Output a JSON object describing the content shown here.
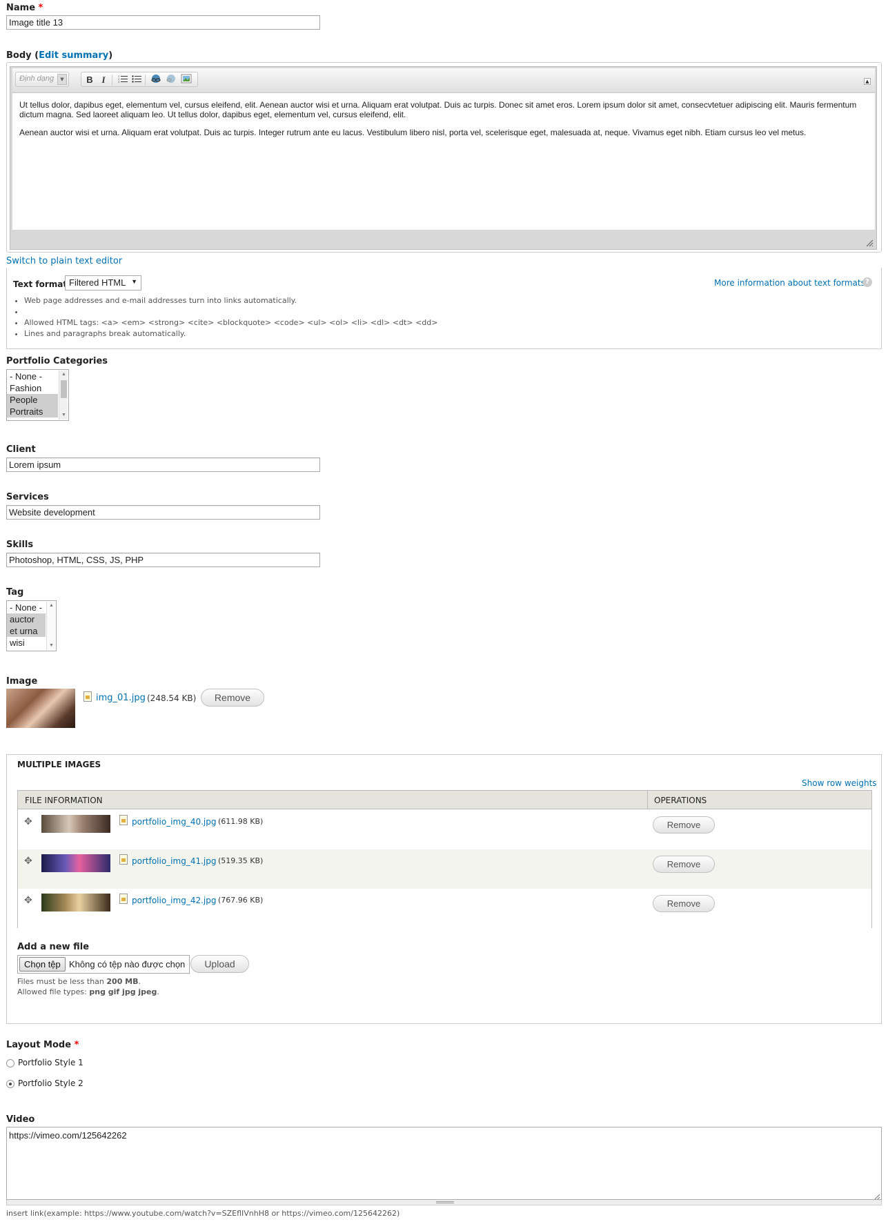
{
  "name": {
    "label": "Name",
    "required_mark": "*",
    "value": "Image title 13"
  },
  "body": {
    "label": "Body",
    "edit_summary": "Edit summary",
    "toolbar": {
      "format_placeholder": "Định dạng",
      "bold": "B",
      "italic": "I",
      "icons": [
        "ordered-list-icon",
        "unordered-list-icon",
        "link-icon",
        "unlink-icon",
        "image-icon"
      ]
    },
    "paragraphs": [
      "Ut tellus dolor, dapibus eget, elementum vel, cursus eleifend, elit. Aenean auctor wisi et urna. Aliquam erat volutpat. Duis ac turpis. Donec sit amet eros. Lorem ipsum dolor sit amet, consecvtetuer adipiscing elit. Mauris fermentum dictum magna. Sed laoreet aliquam leo. Ut tellus dolor, dapibus eget, elementum vel, cursus eleifend, elit.",
      "Aenean auctor wisi et urna. Aliquam erat volutpat. Duis ac turpis. Integer rutrum ante eu lacus. Vestibulum libero nisl, porta vel, scelerisque eget, malesuada at, neque. Vivamus eget nibh. Etiam cursus leo vel metus."
    ],
    "switch_editor": "Switch to plain text editor"
  },
  "text_format": {
    "label": "Text format",
    "selected": "Filtered HTML",
    "more_info": "More information about text formats",
    "tips": [
      "Web page addresses and e-mail addresses turn into links automatically.",
      "",
      "Allowed HTML tags: <a> <em> <strong> <cite> <blockquote> <code> <ul> <ol> <li> <dl> <dt> <dd>",
      "Lines and paragraphs break automatically."
    ]
  },
  "portfolio_categories": {
    "label": "Portfolio Categories",
    "options": [
      "- None -",
      "Fashion",
      "People",
      "Portraits"
    ],
    "selected": [
      "People",
      "Portraits"
    ]
  },
  "client": {
    "label": "Client",
    "value": "Lorem ipsum"
  },
  "services": {
    "label": "Services",
    "value": "Website development"
  },
  "skills": {
    "label": "Skills",
    "value": "Photoshop, HTML, CSS, JS, PHP"
  },
  "tag": {
    "label": "Tag",
    "options": [
      "- None -",
      "auctor",
      "et urna",
      "wisi"
    ],
    "selected": [
      "auctor",
      "et urna"
    ]
  },
  "image": {
    "label": "Image",
    "file_name": "img_01.jpg",
    "file_size": "(248.54 KB)",
    "remove_label": "Remove"
  },
  "multiple_images": {
    "legend": "MULTIPLE IMAGES",
    "show_row_weights": "Show row weights",
    "col_file_info": "FILE INFORMATION",
    "col_operations": "OPERATIONS",
    "rows": [
      {
        "file_name": "portfolio_img_40.jpg",
        "file_size": "(611.98 KB)",
        "remove_label": "Remove"
      },
      {
        "file_name": "portfolio_img_41.jpg",
        "file_size": "(519.35 KB)",
        "remove_label": "Remove"
      },
      {
        "file_name": "portfolio_img_42.jpg",
        "file_size": "(767.96 KB)",
        "remove_label": "Remove"
      }
    ],
    "add_new_label": "Add a new file",
    "choose_file": "Chọn tệp",
    "no_file": "Không có tệp nào được chọn",
    "upload_label": "Upload",
    "size_limit_prefix": "Files must be less than ",
    "size_limit_value": "200 MB",
    "size_limit_suffix": ".",
    "types_prefix": "Allowed file types: ",
    "types_value": "png gif jpg jpeg",
    "types_suffix": "."
  },
  "layout_mode": {
    "label": "Layout Mode",
    "required_mark": "*",
    "options": [
      "Portfolio Style 1",
      "Portfolio Style 2"
    ],
    "selected": "Portfolio Style 2"
  },
  "video": {
    "label": "Video",
    "value": "https://vimeo.com/125642262",
    "help": "insert link(example: https://www.youtube.com/watch?v=SZEflIVnhH8 or https://vimeo.com/125642262)"
  }
}
